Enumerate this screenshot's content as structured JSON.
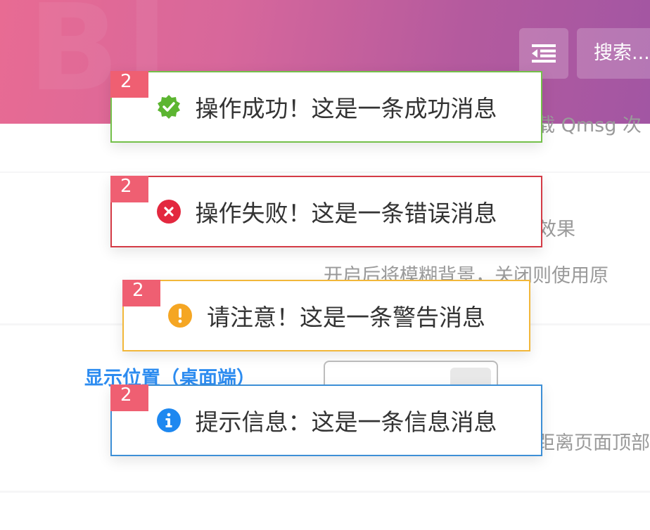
{
  "header": {
    "menu_icon": "menu-collapse-icon",
    "search_label": "搜索..."
  },
  "background": {
    "row1_text": "载 Qmsg 次",
    "row2_text_a": "效果",
    "row2_text_b": "开启后将模糊背景，关闭则使用原",
    "row3_title": "显示位置（桌面端）",
    "row3_desc": "距离页面顶部"
  },
  "toasts": [
    {
      "type": "success",
      "count": "2",
      "icon": "check-badge-icon",
      "message": "操作成功！这是一条成功消息",
      "color": "#74c04a"
    },
    {
      "type": "error",
      "count": "2",
      "icon": "close-circle-icon",
      "message": "操作失败！这是一条错误消息",
      "color": "#d43b46"
    },
    {
      "type": "warning",
      "count": "2",
      "icon": "exclamation-circle-icon",
      "message": "请注意！这是一条警告消息",
      "color": "#f2b73a"
    },
    {
      "type": "info",
      "count": "2",
      "icon": "info-circle-icon",
      "message": "提示信息：这是一条信息消息",
      "color": "#3d8fd6"
    }
  ]
}
